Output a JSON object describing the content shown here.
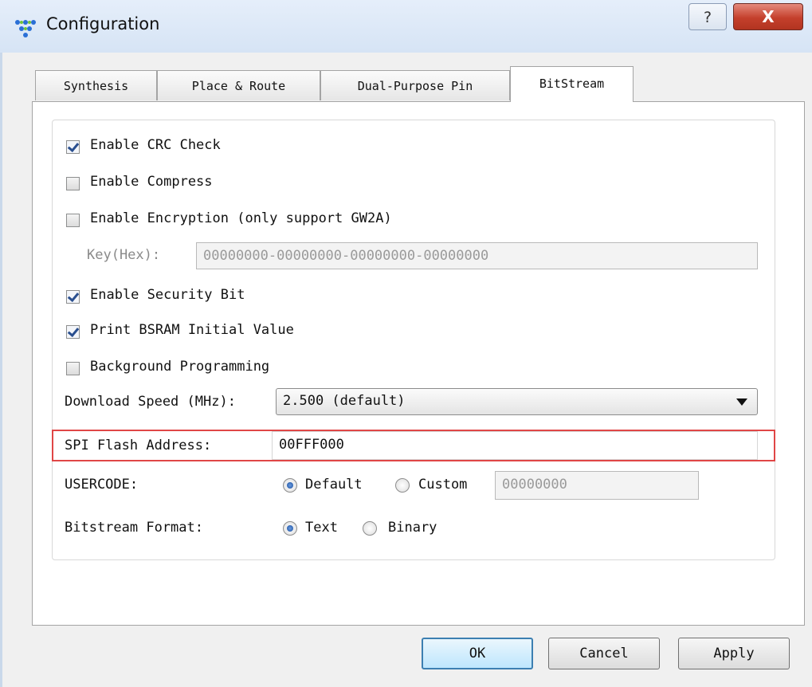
{
  "window": {
    "title": "Configuration",
    "help_label": "?",
    "close_label": "X"
  },
  "tabs": [
    {
      "label": "Synthesis"
    },
    {
      "label": "Place & Route"
    },
    {
      "label": "Dual-Purpose Pin"
    },
    {
      "label": "BitStream"
    }
  ],
  "active_tab": "BitStream",
  "options": {
    "crc": {
      "label": "Enable CRC Check",
      "checked": true
    },
    "compress": {
      "label": "Enable Compress",
      "checked": false
    },
    "encryption": {
      "label": "Enable Encryption (only support GW2A)",
      "checked": false
    },
    "key_label": "Key(Hex):",
    "key_value": "00000000-00000000-00000000-00000000",
    "security": {
      "label": "Enable Security Bit",
      "checked": true
    },
    "bsram": {
      "label": "Print BSRAM Initial Value",
      "checked": true
    },
    "background": {
      "label": "Background Programming",
      "checked": false
    },
    "speed_label": "Download Speed (MHz):",
    "speed_value": "2.500 (default)",
    "spi_label": "SPI Flash Address:",
    "spi_value": "00FFF000",
    "usercode_label": "USERCODE:",
    "usercode_default": "Default",
    "usercode_custom": "Custom",
    "usercode_value": "00000000",
    "usercode_selected": "Default",
    "format_label": "Bitstream Format:",
    "format_text": "Text",
    "format_binary": "Binary",
    "format_selected": "Text"
  },
  "buttons": {
    "ok": "OK",
    "cancel": "Cancel",
    "apply": "Apply"
  },
  "colors": {
    "highlight": "#e04646",
    "accent": "#1a4f9e"
  }
}
